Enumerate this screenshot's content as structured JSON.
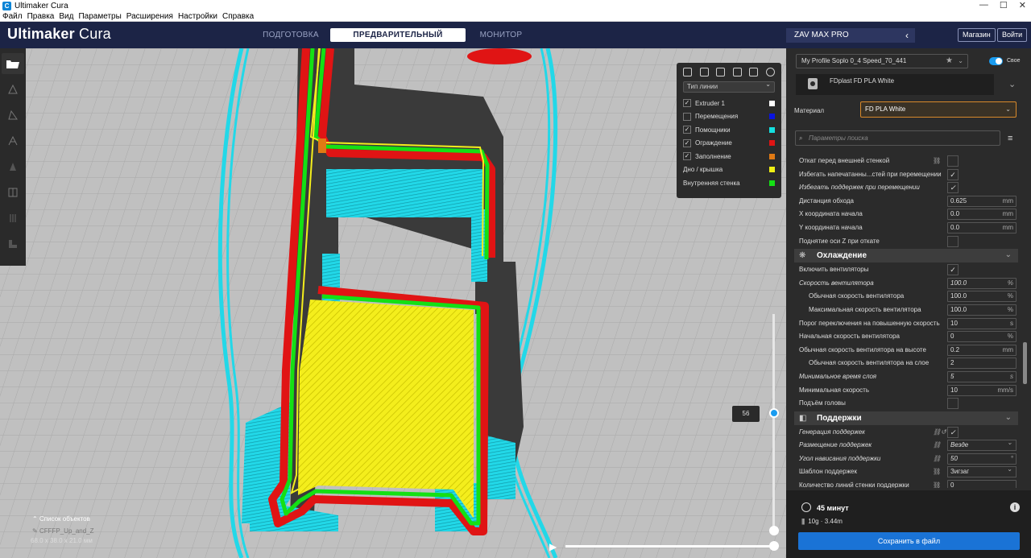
{
  "window": {
    "title": "Ultimaker Cura",
    "minimize": "—",
    "maximize": "☐",
    "close": "✕"
  },
  "menu": [
    "Файл",
    "Правка",
    "Вид",
    "Параметры",
    "Расширения",
    "Настройки",
    "Справка"
  ],
  "header": {
    "logo_brand": "Ultimaker",
    "logo_product": "Cura",
    "stages": [
      {
        "label": "ПОДГОТОВКА",
        "active": false
      },
      {
        "label": "ПРЕДВАРИТЕЛЬНЫЙ ПРОСМОТР",
        "active": true
      },
      {
        "label": "МОНИТОР",
        "active": false
      }
    ],
    "printer": "ZAV MAX PRO",
    "marketplace": "Магазин",
    "signin": "Войти"
  },
  "legend": {
    "line_type": "Тип линии",
    "items": [
      {
        "label": "Extruder 1",
        "checked": true,
        "color": "#ffffff"
      },
      {
        "label": "Перемещения",
        "checked": false,
        "color": "#0a14e0"
      },
      {
        "label": "Помощники",
        "checked": true,
        "color": "#14e0e0"
      },
      {
        "label": "Ограждение",
        "checked": true,
        "color": "#e01414"
      },
      {
        "label": "Заполнение",
        "checked": true,
        "color": "#e07a14"
      },
      {
        "label": "Дно / крышка",
        "checked": null,
        "color": "#f0f014"
      },
      {
        "label": "Внутренняя стенка",
        "checked": null,
        "color": "#14e014"
      }
    ]
  },
  "objects": {
    "list_label": "Список объектов",
    "name": "CFFFP_Up_and_Z",
    "dims": "68.0 x 38.0 x 21.0 мм"
  },
  "layer": {
    "current": "56"
  },
  "panel": {
    "profile": "My Profile Soplo 0_4 Speed_70_441",
    "custom_label": "Свое",
    "extruder_material": "FDplast FD PLA White",
    "material_label": "Материал",
    "material_value": "FD PLA White",
    "search_placeholder": "Параметры поиска",
    "settings": [
      {
        "label": "Откат перед внешней стенкой",
        "type": "check",
        "value": "",
        "link": true
      },
      {
        "label": "Избегать напечатанны...стей при перемещении",
        "type": "check",
        "value": "✓"
      },
      {
        "label": "Избегать поддержек при перемещении",
        "type": "check",
        "value": "✓",
        "italic": true
      },
      {
        "label": "Дистанция обхода",
        "type": "num",
        "value": "0.625",
        "unit": "mm"
      },
      {
        "label": "X координата начала",
        "type": "num",
        "value": "0.0",
        "unit": "mm"
      },
      {
        "label": "Y координата начала",
        "type": "num",
        "value": "0.0",
        "unit": "mm"
      },
      {
        "label": "Поднятие оси Z при откате",
        "type": "check",
        "value": ""
      },
      {
        "category": "Охлаждение",
        "icon": "❋"
      },
      {
        "label": "Включить вентиляторы",
        "type": "check",
        "value": "✓"
      },
      {
        "label": "Скорость вентилятора",
        "type": "num",
        "value": "100.0",
        "unit": "%",
        "italic": true
      },
      {
        "label": "Обычная скорость вентилятора",
        "type": "num",
        "value": "100.0",
        "unit": "%",
        "indent": true
      },
      {
        "label": "Максимальная скорость вентилятора",
        "type": "num",
        "value": "100.0",
        "unit": "%",
        "indent": true
      },
      {
        "label": "Порог переключения на повышенную скорость",
        "type": "num",
        "value": "10",
        "unit": "s"
      },
      {
        "label": "Начальная скорость вентилятора",
        "type": "num",
        "value": "0",
        "unit": "%"
      },
      {
        "label": "Обычная скорость вентилятора на высоте",
        "type": "num",
        "value": "0.2",
        "unit": "mm"
      },
      {
        "label": "Обычная скорость вентилятора на слое",
        "type": "num",
        "value": "2",
        "unit": "",
        "indent": true
      },
      {
        "label": "Минимальное время слоя",
        "type": "num",
        "value": "5",
        "unit": "s",
        "italic": true
      },
      {
        "label": "Минимальная скорость",
        "type": "num",
        "value": "10",
        "unit": "mm/s"
      },
      {
        "label": "Подъём головы",
        "type": "check",
        "value": ""
      },
      {
        "category": "Поддержки",
        "icon": "◧"
      },
      {
        "label": "Генерация поддержек",
        "type": "check",
        "value": "✓",
        "italic": true,
        "link": true,
        "reset": true
      },
      {
        "label": "Размещение поддержек",
        "type": "select",
        "value": "Везде",
        "italic": true,
        "link": true
      },
      {
        "label": "Угол нависания поддержки",
        "type": "num",
        "value": "50",
        "unit": "°",
        "italic": true,
        "link": true
      },
      {
        "label": "Шаблон поддержек",
        "type": "select",
        "value": "Зигзаг",
        "link": true
      },
      {
        "label": "Количество линий стенки поддержки",
        "type": "num",
        "value": "0",
        "unit": "",
        "link": true
      }
    ],
    "estimate": {
      "time": "45 минут",
      "filament": "10g · 3.44m"
    },
    "save_button": "Сохранить в файл"
  }
}
